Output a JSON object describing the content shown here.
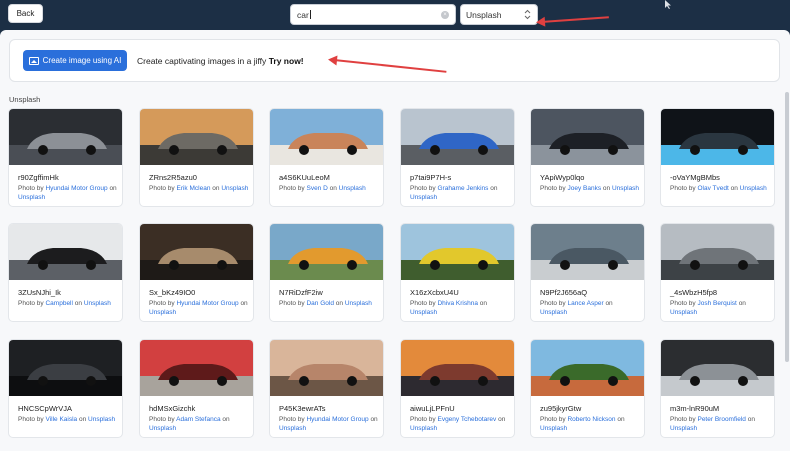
{
  "toolbar": {
    "back_label": "Back",
    "search_value": "car",
    "source_value": "Unsplash",
    "clear_glyph": "×",
    "chevron_glyph": "⌃⌄"
  },
  "promo": {
    "button_label": "Create image using AI",
    "text": "Create captivating images in a jiffy",
    "link": "Try now!"
  },
  "section_label": "Unsplash",
  "photos": [
    {
      "id": "r90ZgffimHk",
      "by": "Photo by",
      "author": "Hyundai Motor Group",
      "on": "on",
      "site": "Unsplash"
    },
    {
      "id": "ZRns2R5azu0",
      "by": "Photo by",
      "author": "Erik Mclean",
      "on": "on",
      "site": "Unsplash"
    },
    {
      "id": "a4S6KUuLeoM",
      "by": "Photo by",
      "author": "Sven D",
      "on": "on",
      "site": "Unsplash"
    },
    {
      "id": "p7tai9P7H-s",
      "by": "Photo by",
      "author": "Grahame Jenkins",
      "on": "on",
      "site": "Unsplash"
    },
    {
      "id": "YApiWyp0lqo",
      "by": "Photo by",
      "author": "Joey Banks",
      "on": "on",
      "site": "Unsplash"
    },
    {
      "id": "-oVaYMgBMbs",
      "by": "Photo by",
      "author": "Olav Tvedt",
      "on": "on",
      "site": "Unsplash"
    },
    {
      "id": "3ZUsNJhi_Ik",
      "by": "Photo by",
      "author": "Campbell",
      "on": "on",
      "site": "Unsplash"
    },
    {
      "id": "Sx_bKz49IO0",
      "by": "Photo by",
      "author": "Hyundai Motor Group",
      "on": "on",
      "site": "Unsplash"
    },
    {
      "id": "N7RiDzfF2iw",
      "by": "Photo by",
      "author": "Dan Gold",
      "on": "on",
      "site": "Unsplash"
    },
    {
      "id": "X16zXcbxU4U",
      "by": "Photo by",
      "author": "Dhiva Krishna",
      "on": "on",
      "site": "Unsplash"
    },
    {
      "id": "N9Pf2J656aQ",
      "by": "Photo by",
      "author": "Lance Asper",
      "on": "on",
      "site": "Unsplash"
    },
    {
      "id": "_4sWbzH5fp8",
      "by": "Photo by",
      "author": "Josh Berquist",
      "on": "on",
      "site": "Unsplash"
    },
    {
      "id": "HNCSCpWrVJA",
      "by": "Photo by",
      "author": "Ville Kaisla",
      "on": "on",
      "site": "Unsplash"
    },
    {
      "id": "hdMSxGizchk",
      "by": "Photo by",
      "author": "Adam Stefanca",
      "on": "on",
      "site": "Unsplash"
    },
    {
      "id": "P45K3ewrATs",
      "by": "Photo by",
      "author": "Hyundai Motor Group",
      "on": "on",
      "site": "Unsplash"
    },
    {
      "id": "aiwuLjLPFnU",
      "by": "Photo by",
      "author": "Evgeny Tchebotarev",
      "on": "on",
      "site": "Unsplash"
    },
    {
      "id": "zu95jkyrGtw",
      "by": "Photo by",
      "author": "Roberto Nickson",
      "on": "on",
      "site": "Unsplash"
    },
    {
      "id": "m3m-lnR90uM",
      "by": "Photo by",
      "author": "Peter Broomfield",
      "on": "on",
      "site": "Unsplash"
    }
  ],
  "thumb_palettes": [
    [
      "#2b2e33",
      "#8c9096",
      "#4a4e55"
    ],
    [
      "#d59a5a",
      "#6d6a64",
      "#3c3a36"
    ],
    [
      "#7fb0d8",
      "#c9845a",
      "#e9e6e0"
    ],
    [
      "#b9c4cf",
      "#2f66c6",
      "#5a5e63"
    ],
    [
      "#4d5560",
      "#1d2026",
      "#8b939c"
    ],
    [
      "#0f1318",
      "#2a3640",
      "#4cb7e8"
    ],
    [
      "#e6e8ea",
      "#1c1c1e",
      "#5c6066"
    ],
    [
      "#3b2e24",
      "#a78b6c",
      "#1e1a17"
    ],
    [
      "#79a8c9",
      "#e29a2e",
      "#6b8b4e"
    ],
    [
      "#9ec4dd",
      "#e2c82c",
      "#3f5d2e"
    ],
    [
      "#6d7f8c",
      "#4a5863",
      "#c9cdd0"
    ],
    [
      "#b6bcc2",
      "#6f7479",
      "#3d4246"
    ],
    [
      "#1e2023",
      "#3b3e43",
      "#0d0e10"
    ],
    [
      "#d24040",
      "#5e1a1a",
      "#a8a39c"
    ],
    [
      "#d9b59a",
      "#b7856a",
      "#6c5646"
    ],
    [
      "#e38a3b",
      "#7d3a2e",
      "#2d2a30"
    ],
    [
      "#7fb9e0",
      "#3a6a2a",
      "#c76a3d"
    ],
    [
      "#2b2d30",
      "#8c9196",
      "#c5c9cd"
    ]
  ]
}
